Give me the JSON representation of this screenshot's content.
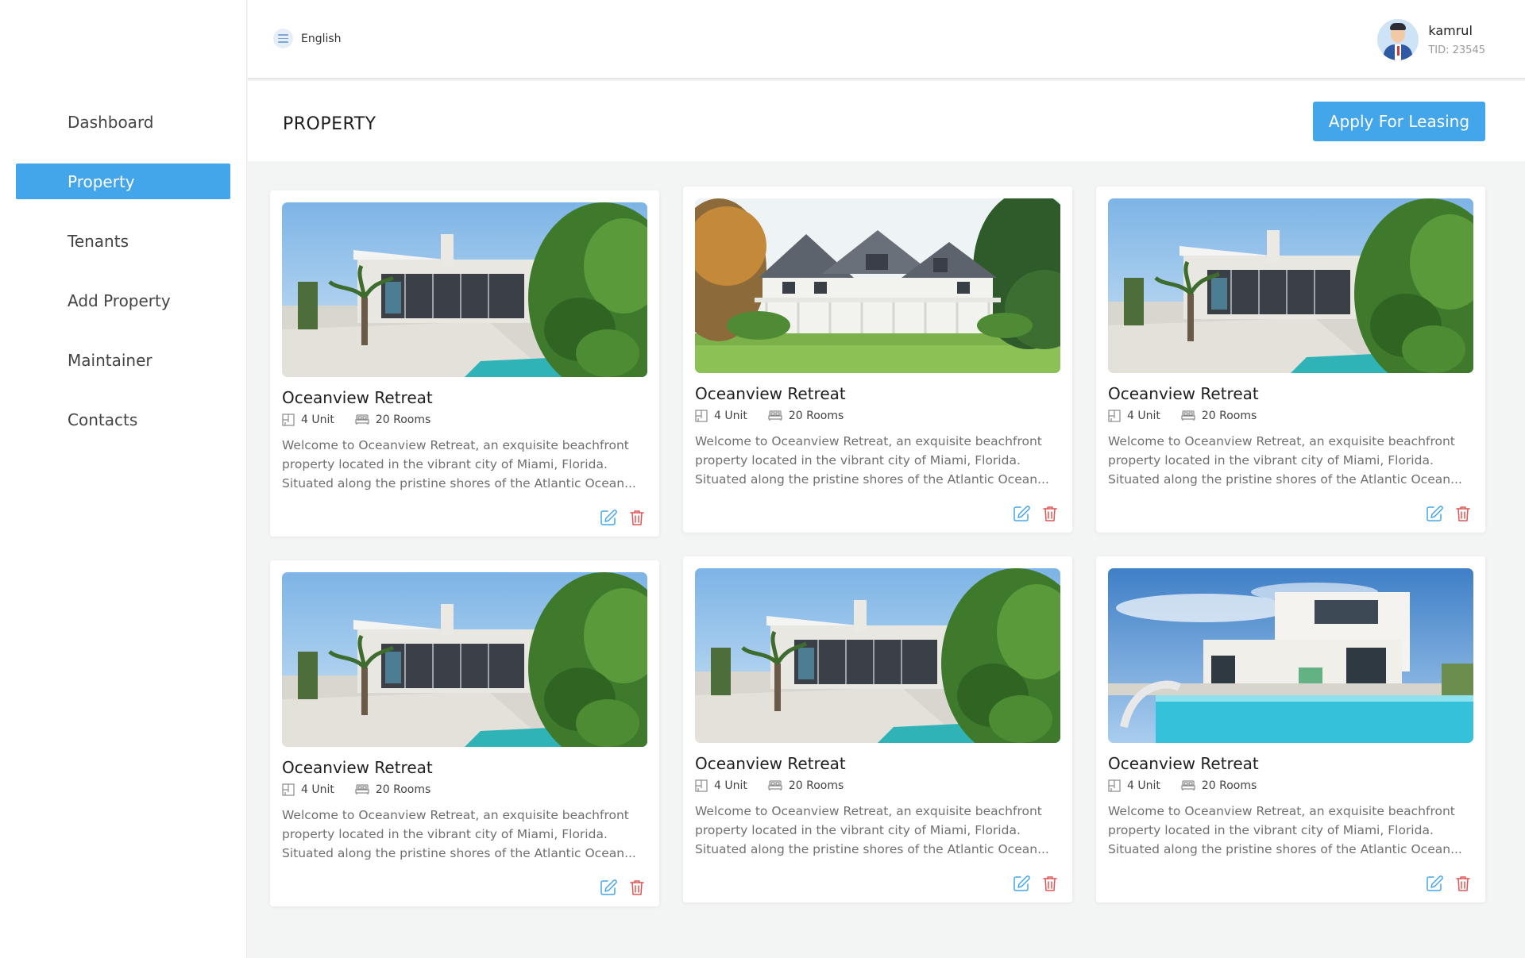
{
  "sidebar": {
    "items": [
      {
        "label": "Dashboard",
        "active": false
      },
      {
        "label": "Property",
        "active": true
      },
      {
        "label": "Tenants",
        "active": false
      },
      {
        "label": "Add Property",
        "active": false
      },
      {
        "label": "Maintainer",
        "active": false
      },
      {
        "label": "Contacts",
        "active": false
      }
    ]
  },
  "header": {
    "language": "English",
    "menu_icon": "menu-icon",
    "user": {
      "name": "kamrul",
      "tid": "TID: 23545",
      "avatar_icon": "avatar-icon"
    }
  },
  "page": {
    "title": "PROPERTY",
    "apply_button": "Apply For Leasing"
  },
  "colors": {
    "accent": "#43a5ea",
    "edit": "#43a5ea",
    "delete": "#e05656"
  },
  "cards": [
    {
      "title": "Oceanview Retreat",
      "units": "4 Unit",
      "rooms": "20 Rooms",
      "image": "modern-house-photo",
      "description": "Welcome to Oceanview Retreat, an exquisite beachfront property located in the vibrant city of Miami, Florida. Situated along the pristine shores of the Atlantic Ocean..."
    },
    {
      "title": "Oceanview Retreat",
      "units": "4 Unit",
      "rooms": "20 Rooms",
      "image": "classic-house-photo",
      "description": "Welcome to Oceanview Retreat, an exquisite beachfront property located in the vibrant city of Miami, Florida. Situated along the pristine shores of the Atlantic Ocean..."
    },
    {
      "title": "Oceanview Retreat",
      "units": "4 Unit",
      "rooms": "20 Rooms",
      "image": "modern-house-photo",
      "description": "Welcome to Oceanview Retreat, an exquisite beachfront property located in the vibrant city of Miami, Florida. Situated along the pristine shores of the Atlantic Ocean..."
    },
    {
      "title": "Oceanview Retreat",
      "units": "4 Unit",
      "rooms": "20 Rooms",
      "image": "modern-house-photo",
      "description": "Welcome to Oceanview Retreat, an exquisite beachfront property located in the vibrant city of Miami, Florida. Situated along the pristine shores of the Atlantic Ocean..."
    },
    {
      "title": "Oceanview Retreat",
      "units": "4 Unit",
      "rooms": "20 Rooms",
      "image": "modern-house-photo",
      "description": "Welcome to Oceanview Retreat, an exquisite beachfront property located in the vibrant city of Miami, Florida. Situated along the pristine shores of the Atlantic Ocean..."
    },
    {
      "title": "Oceanview Retreat",
      "units": "4 Unit",
      "rooms": "20 Rooms",
      "image": "pool-villa-photo",
      "description": "Welcome to Oceanview Retreat, an exquisite beachfront property located in the vibrant city of Miami, Florida. Situated along the pristine shores of the Atlantic Ocean..."
    }
  ]
}
